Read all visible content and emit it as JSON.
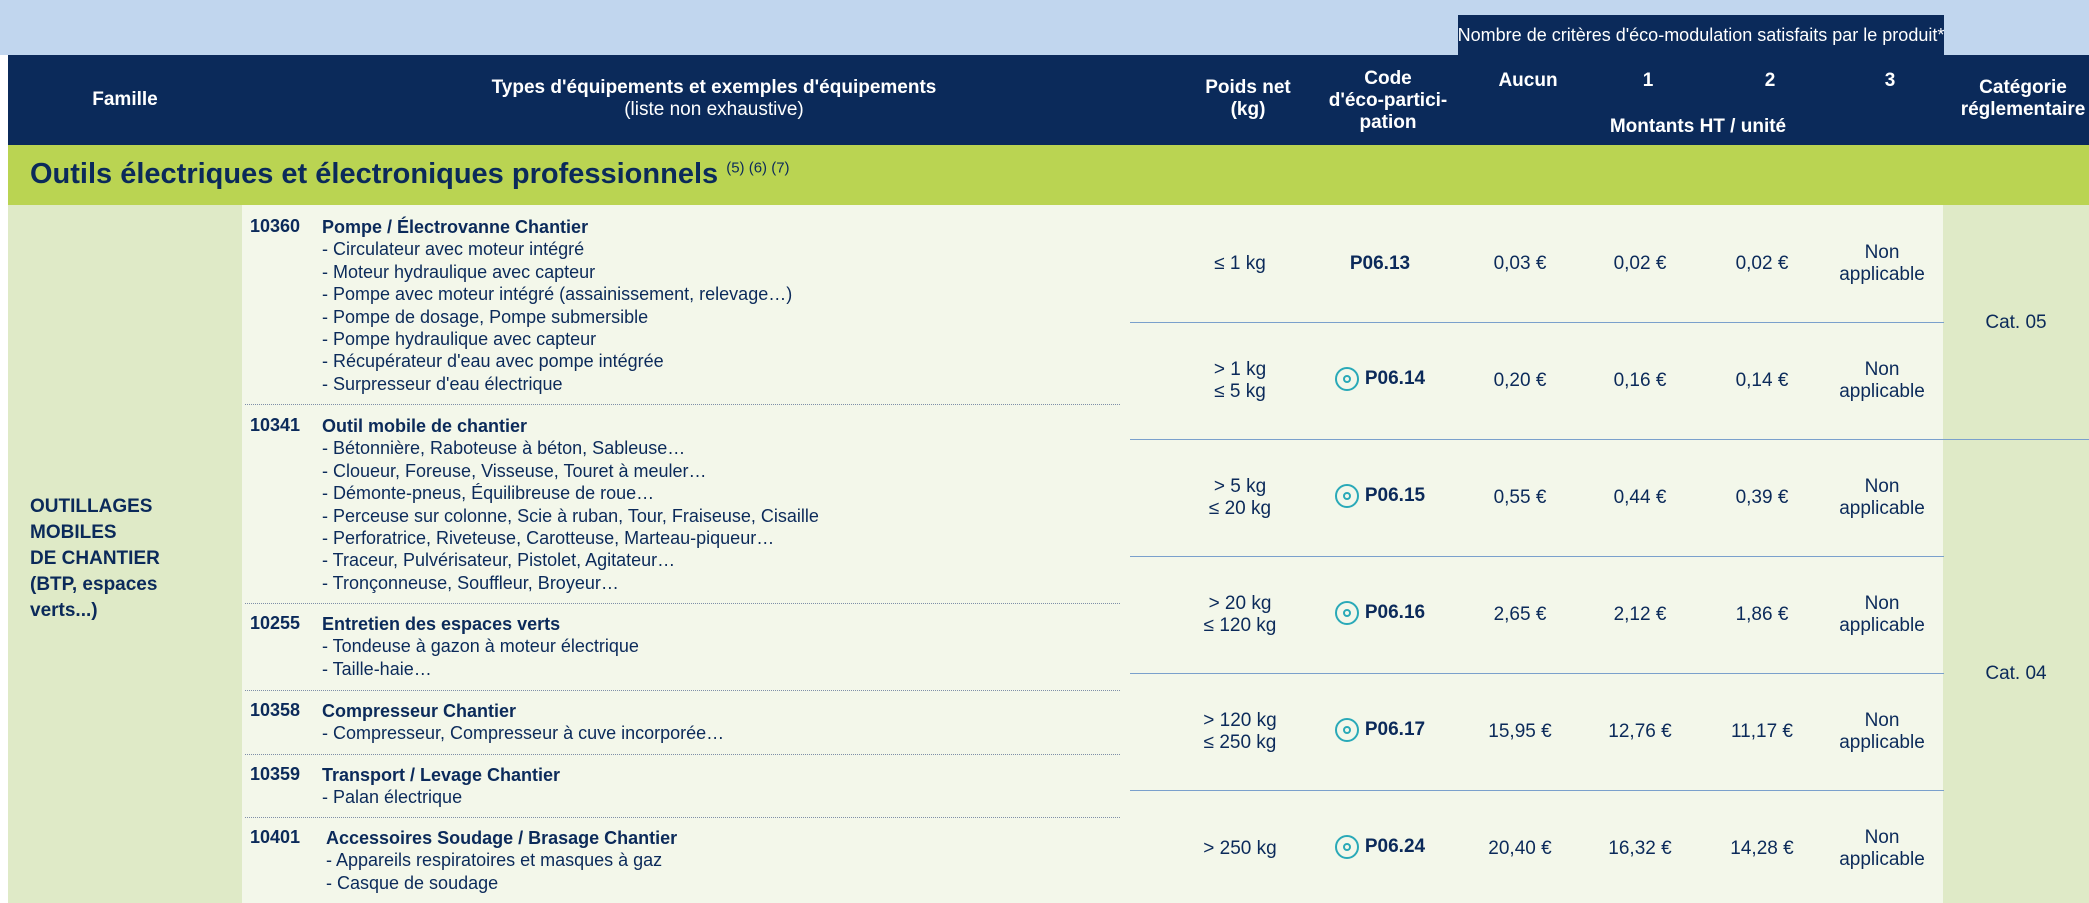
{
  "header": {
    "criteria_banner": "Nombre de critères d'éco-modulation satisfaits par le produit*",
    "famille": "Famille",
    "types_line1": "Types d'équipements et exemples d'équipements",
    "types_line2": "(liste non exhaustive)",
    "poids_line1": "Poids net",
    "poids_line2": "(kg)",
    "code_line1": "Code",
    "code_line2": "d'éco-partici-",
    "code_line3": "pation",
    "aucun": "Aucun",
    "c1": "1",
    "c2": "2",
    "c3": "3",
    "montants": "Montants HT / unité",
    "categorie_line1": "Catégorie",
    "categorie_line2": "réglementaire"
  },
  "section": {
    "title": "Outils électriques et électroniques professionnels",
    "refs": "(5) (6) (7)"
  },
  "family": {
    "line1": "OUTILLAGES",
    "line2": "MOBILES",
    "line3": "DE CHANTIER",
    "line4": "(BTP, espaces",
    "line5": "verts...)"
  },
  "items": [
    {
      "code": "10360",
      "title": "Pompe / Électrovanne Chantier",
      "lines": [
        "- Circulateur avec moteur intégré",
        "- Moteur hydraulique avec capteur",
        "- Pompe avec moteur intégré (assainissement, relevage…)",
        "- Pompe de dosage, Pompe submersible",
        "- Pompe hydraulique avec capteur",
        "- Récupérateur d'eau avec pompe intégrée",
        "- Surpresseur d'eau électrique"
      ]
    },
    {
      "code": "10341",
      "title": "Outil mobile de chantier",
      "lines": [
        "- Bétonnière, Raboteuse à béton, Sableuse…",
        "- Cloueur, Foreuse, Visseuse, Touret à meuler…",
        "- Démonte-pneus, Équilibreuse de roue…",
        "- Perceuse sur colonne, Scie à ruban, Tour, Fraiseuse, Cisaille",
        "- Perforatrice, Riveteuse, Carotteuse, Marteau-piqueur…",
        "- Traceur, Pulvérisateur, Pistolet, Agitateur…",
        "- Tronçonneuse, Souffleur, Broyeur…"
      ]
    },
    {
      "code": "10255",
      "title": "Entretien des espaces verts",
      "lines": [
        "- Tondeuse à gazon à moteur électrique",
        "- Taille-haie…"
      ]
    },
    {
      "code": "10358",
      "title": "Compresseur Chantier",
      "lines": [
        "- Compresseur, Compresseur à cuve incorporée…"
      ]
    },
    {
      "code": "10359",
      "title": "Transport / Levage Chantier",
      "lines": [
        "- Palan électrique"
      ]
    },
    {
      "code": "10401",
      "title": "Accessoires Soudage / Brasage Chantier",
      "lines": [
        "- Appareils respiratoires et masques à gaz",
        "- Casque de soudage"
      ]
    }
  ],
  "rows": [
    {
      "poids1": "≤ 1 kg",
      "poids2": "",
      "code": "P06.13",
      "icon": "",
      "aucun": "0,03 €",
      "c1": "0,02 €",
      "c2": "0,02 €",
      "c3a": "Non",
      "c3b": "applicable"
    },
    {
      "poids1": "> 1 kg",
      "poids2": "≤ 5 kg",
      "code": "P06.14",
      "icon": "eco-target-icon",
      "aucun": "0,20 €",
      "c1": "0,16 €",
      "c2": "0,14 €",
      "c3a": "Non",
      "c3b": "applicable"
    },
    {
      "poids1": "> 5 kg",
      "poids2": "≤ 20 kg",
      "code": "P06.15",
      "icon": "eco-target-icon",
      "aucun": "0,55 €",
      "c1": "0,44 €",
      "c2": "0,39 €",
      "c3a": "Non",
      "c3b": "applicable"
    },
    {
      "poids1": "> 20 kg",
      "poids2": "≤ 120 kg",
      "code": "P06.16",
      "icon": "eco-target-icon",
      "aucun": "2,65 €",
      "c1": "2,12 €",
      "c2": "1,86 €",
      "c3a": "Non",
      "c3b": "applicable"
    },
    {
      "poids1": "> 120 kg",
      "poids2": "≤ 250 kg",
      "code": "P06.17",
      "icon": "eco-target-icon",
      "aucun": "15,95 €",
      "c1": "12,76 €",
      "c2": "11,17 €",
      "c3a": "Non",
      "c3b": "applicable"
    },
    {
      "poids1": "> 250 kg",
      "poids2": "",
      "code": "P06.24",
      "icon": "eco-target-icon",
      "aucun": "20,40 €",
      "c1": "16,32 €",
      "c2": "14,28 €",
      "c3a": "Non",
      "c3b": "applicable"
    }
  ],
  "categories": {
    "cat05": "Cat. 05",
    "cat04": "Cat. 04"
  }
}
